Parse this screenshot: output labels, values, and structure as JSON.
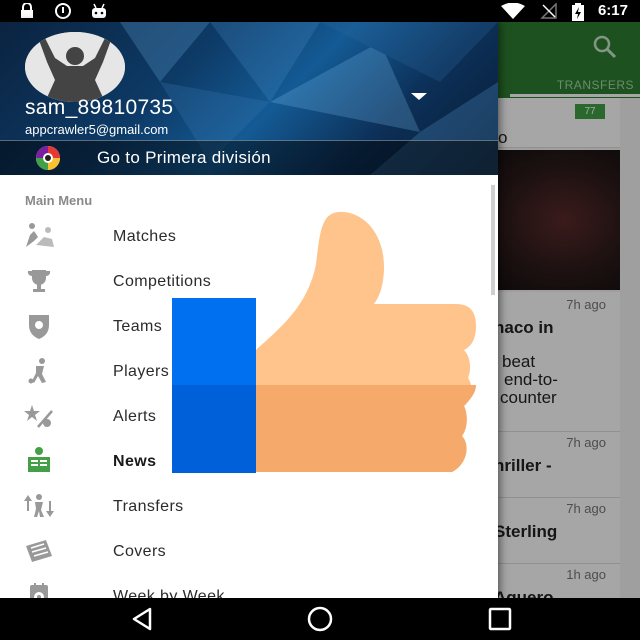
{
  "status_bar": {
    "time": "6:17",
    "icons": [
      "lock-icon",
      "alert-circle-icon",
      "android-icon",
      "wifi-icon",
      "no-signal-icon",
      "battery-charging-icon"
    ]
  },
  "app": {
    "tab_label": "TRANSFERS",
    "comment_count": "77",
    "cards": [
      {
        "time": "7h ago",
        "lines": [
          "naco in",
          "",
          "beat",
          "end-to-",
          "counter"
        ]
      },
      {
        "time": "7h ago",
        "lines": [
          "hriller -"
        ]
      },
      {
        "time": "7h ago",
        "lines": [
          "Sterling"
        ]
      },
      {
        "time": "1h ago",
        "lines": [
          "Aguero"
        ]
      }
    ],
    "card_partial_letter": "o"
  },
  "drawer": {
    "username": "sam_89810735",
    "email": "appcrawler5@gmail.com",
    "league_label": "Go to Primera división",
    "menu_header": "Main Menu",
    "items": [
      {
        "label": "Matches",
        "icon": "players-tackle-icon"
      },
      {
        "label": "Competitions",
        "icon": "trophy-icon"
      },
      {
        "label": "Teams",
        "icon": "shield-icon"
      },
      {
        "label": "Players",
        "icon": "player-icon"
      },
      {
        "label": "Alerts",
        "icon": "alert-star-icon"
      },
      {
        "label": "News",
        "icon": "news-icon",
        "active": true
      },
      {
        "label": "Transfers",
        "icon": "transfer-icon"
      },
      {
        "label": "Covers",
        "icon": "newspaper-icon"
      },
      {
        "label": "Week by Week",
        "icon": "calendar-ball-icon"
      }
    ]
  },
  "colors": {
    "app_green": "#2e7d32",
    "active_icon_green": "#43a047",
    "thumb_skin_light": "#FFC48C",
    "thumb_skin_dark": "#F5A96B",
    "cuff_blue": "#0070F0"
  }
}
